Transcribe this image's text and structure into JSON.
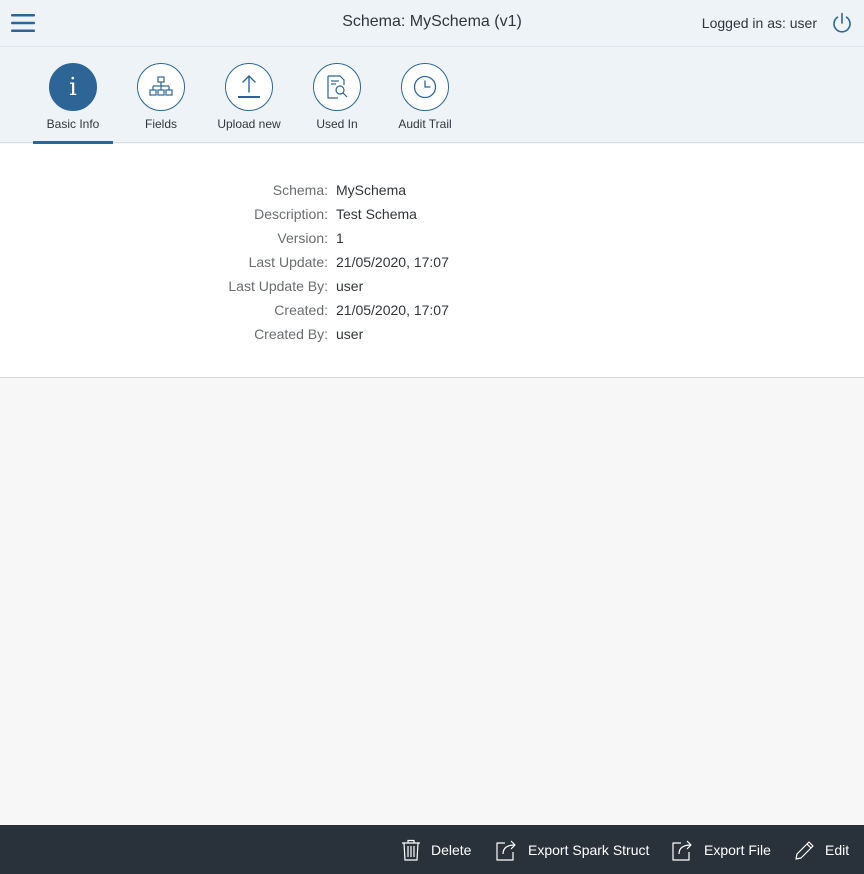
{
  "header": {
    "title": "Schema: MySchema (v1)",
    "logged_in": "Logged in as: user",
    "menu_icon": "hamburger-menu-icon",
    "power_icon": "power-icon"
  },
  "tabs": [
    {
      "label": "Basic Info",
      "icon": "info-icon",
      "selected": true
    },
    {
      "label": "Fields",
      "icon": "hierarchy-icon",
      "selected": false
    },
    {
      "label": "Upload new",
      "icon": "upload-icon",
      "selected": false
    },
    {
      "label": "Used In",
      "icon": "document-search-icon",
      "selected": false
    },
    {
      "label": "Audit Trail",
      "icon": "clock-icon",
      "selected": false
    }
  ],
  "info": [
    {
      "label": "Schema:",
      "value": "MySchema"
    },
    {
      "label": "Description:",
      "value": "Test Schema"
    },
    {
      "label": "Version:",
      "value": "1"
    },
    {
      "label": "Last Update:",
      "value": "21/05/2020, 17:07"
    },
    {
      "label": "Last Update By:",
      "value": "user"
    },
    {
      "label": "Created:",
      "value": "21/05/2020, 17:07"
    },
    {
      "label": "Created By:",
      "value": "user"
    }
  ],
  "footer": {
    "delete": "Delete",
    "export_spark": "Export Spark Struct",
    "export_file": "Export File",
    "edit": "Edit"
  },
  "colors": {
    "accent": "#2d6596",
    "header_bg": "#eef3f8",
    "footer_bg": "#29313a"
  }
}
